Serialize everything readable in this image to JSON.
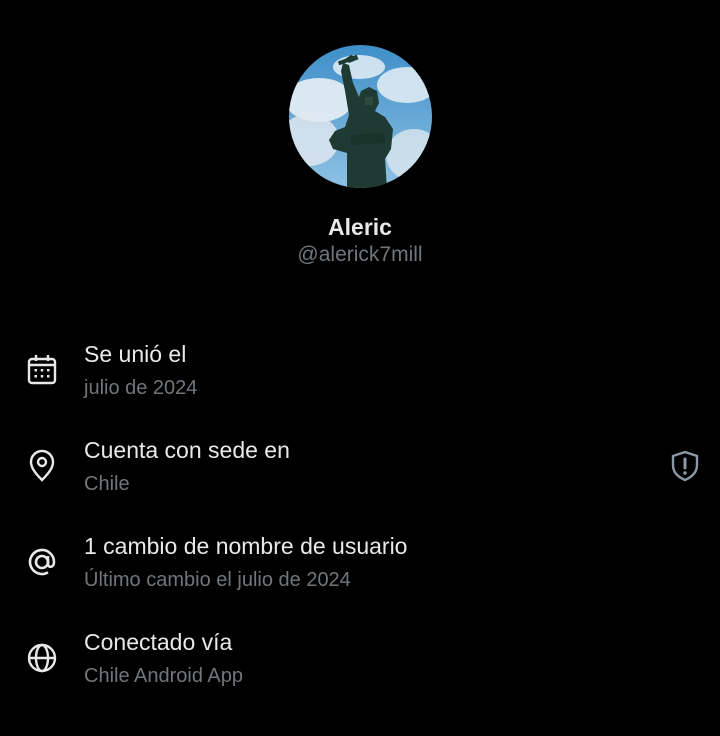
{
  "profile": {
    "display_name": "Aleric",
    "handle": "@alerick7mill",
    "avatar_description": "statue-photo"
  },
  "colors": {
    "background": "#000000",
    "primary_text": "#e7e9ea",
    "secondary_text": "#71767b"
  },
  "rows": [
    {
      "icon": "calendar-icon",
      "title": "Se unió el",
      "subtitle": "julio de 2024"
    },
    {
      "icon": "location-pin-icon",
      "title": "Cuenta con sede en",
      "subtitle": "Chile",
      "trailing_icon": "shield-alert-icon"
    },
    {
      "icon": "at-sign-icon",
      "title": "1 cambio de nombre de usuario",
      "subtitle": "Último cambio el julio de 2024"
    },
    {
      "icon": "globe-icon",
      "title": "Conectado vía",
      "subtitle": "Chile Android App"
    }
  ]
}
